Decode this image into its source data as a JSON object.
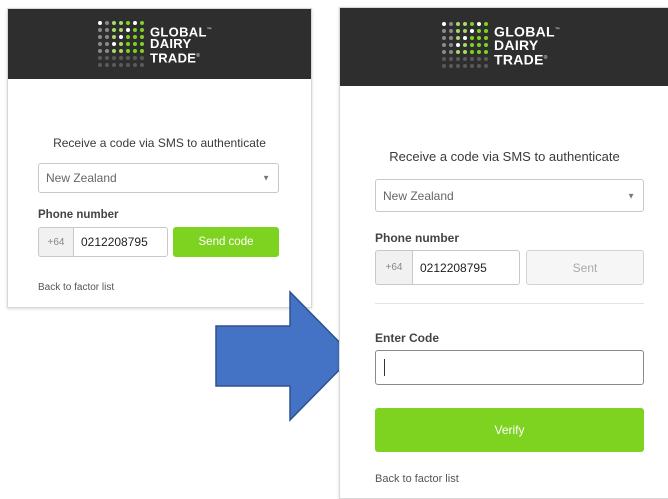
{
  "brand": {
    "line1": "GLOBAL",
    "line2": "DAIRY",
    "line3": "TRADE",
    "tm": "™",
    "registered": "®",
    "header_color": "#2e2e2e",
    "dot_colors": [
      "#7ed321",
      "#a8d96a",
      "#8a8a8a",
      "#5a5a5a",
      "#ffffff"
    ]
  },
  "step1": {
    "heading": "Receive a code via SMS to authenticate",
    "country": "New Zealand",
    "phone_label": "Phone number",
    "country_code": "+64",
    "phone_number": "0212208795",
    "send_button": "Send code",
    "back_link": "Back to factor list"
  },
  "step2": {
    "heading": "Receive a code via SMS to authenticate",
    "country": "New Zealand",
    "phone_label": "Phone number",
    "country_code": "+64",
    "phone_number": "0212208795",
    "sent_button": "Sent",
    "code_label": "Enter Code",
    "code_value": "",
    "verify_button": "Verify",
    "back_link": "Back to factor list"
  },
  "colors": {
    "accent_green": "#7ed321",
    "arrow_fill": "#4472c4",
    "arrow_stroke": "#2f528f"
  }
}
